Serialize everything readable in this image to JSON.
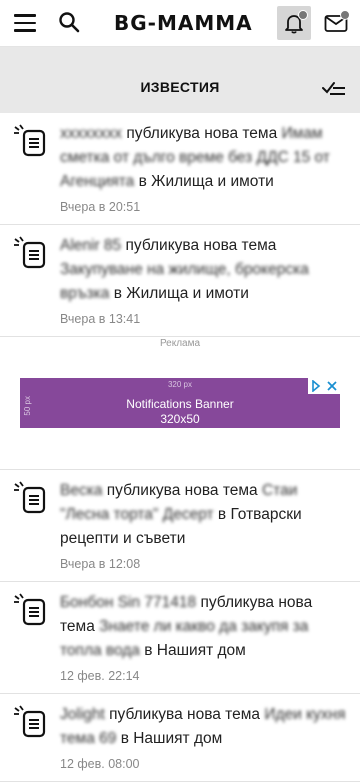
{
  "header": {
    "logo": "BG-MAMMA",
    "menu_icon": "menu-icon",
    "search_icon": "search-icon",
    "bell_icon": "bell-icon",
    "mail_icon": "mail-icon"
  },
  "notifications": {
    "title": "ИЗВЕСТИЯ",
    "mark_read_icon": "check-all-icon",
    "items": [
      {
        "user": "xxxxxxxx",
        "action": "публикува нова тема",
        "topic": "Имам сметка от дълго време без ДДС 15 от Агенцията",
        "preposition": "в",
        "category": "Жилища и имоти",
        "time": "Вчера в 20:51"
      },
      {
        "user": "Alenir 85",
        "action": "публикува нова тема",
        "topic": "Закупуване на жилище, брокерска връзка",
        "preposition": "в",
        "category": "Жилища и имоти",
        "time": "Вчера в 13:41"
      },
      {
        "user": "Веска",
        "action": "публикува нова тема",
        "topic": "Стаи \"Лесна торта\" Десерт",
        "preposition": "в",
        "category": "Готварски рецепти и съвети",
        "time": "Вчера в 12:08"
      },
      {
        "user": "Бонбон Sin 771418",
        "action": "публикува нова тема",
        "topic": "Знаете ли какво да закупя за топла вода",
        "preposition": "в",
        "category": "Нашият дом",
        "time": "12 фев. 22:14"
      },
      {
        "user": "Jolight",
        "action": "публикува нова тема",
        "topic": "Идеи кухня тема 69",
        "preposition": "в",
        "category": "Нашият дом",
        "time": "12 фев. 08:00"
      }
    ]
  },
  "ad": {
    "label": "Реклама",
    "width_text": "320 px",
    "height_text": "50 px",
    "line1": "Notifications Banner",
    "line2": "320x50"
  }
}
